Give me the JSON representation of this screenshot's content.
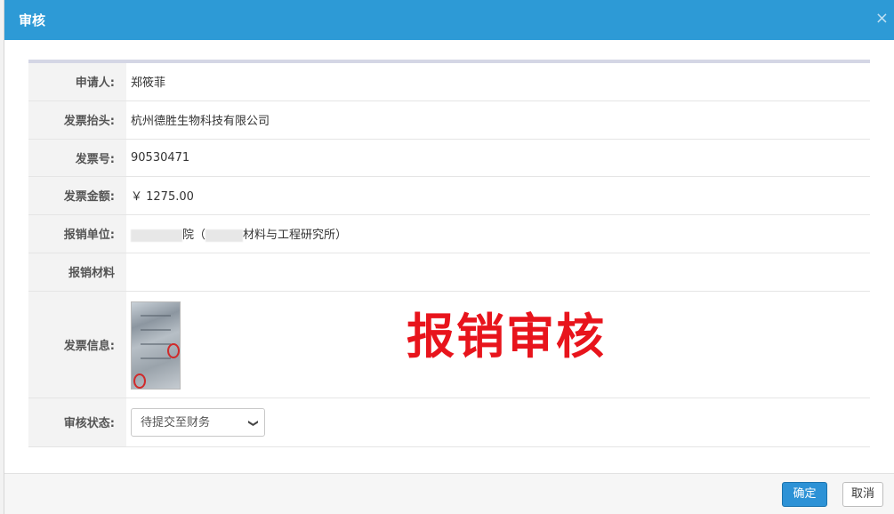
{
  "dialog": {
    "title": "审核",
    "close_glyph": "×"
  },
  "fields": {
    "applicant": {
      "label": "申请人:",
      "value": "郑筱菲"
    },
    "invoice_title": {
      "label": "发票抬头:",
      "value": "杭州德胜生物科技有限公司"
    },
    "invoice_number": {
      "label": "发票号:",
      "value": "90530471"
    },
    "invoice_amount": {
      "label": "发票金额:",
      "value": "￥ 1275.00"
    },
    "reimburse_unit": {
      "label": "报销单位:",
      "value_part1": "院（",
      "value_part2": "材料与工程研究所）"
    },
    "reimburse_material": {
      "label": "报销材料",
      "value": ""
    },
    "invoice_info": {
      "label": "发票信息:"
    },
    "review_status": {
      "label": "审核状态:",
      "selected": "待提交至财务"
    }
  },
  "overlay": {
    "text": "报销审核",
    "color": "#e8141c"
  },
  "footer": {
    "ok_label": "确定",
    "cancel_label": "取消"
  },
  "colors": {
    "header": "#2d9ad6",
    "primary_button": "#2d92d6"
  },
  "icons": {
    "close": "close-icon",
    "dropdown": "chevron-down-icon",
    "invoice_thumbnail": "invoice-image"
  }
}
